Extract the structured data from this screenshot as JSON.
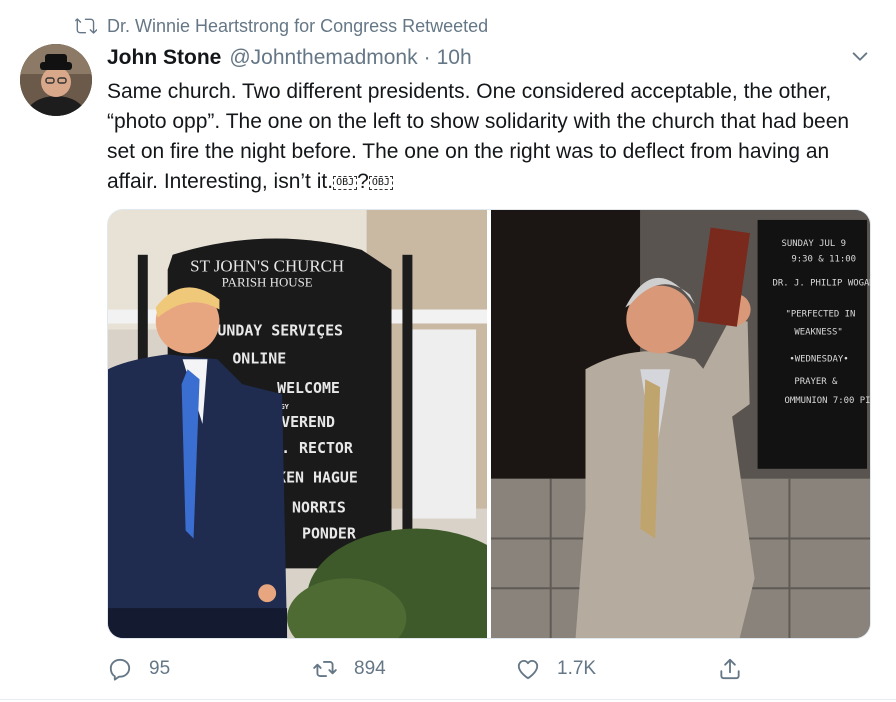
{
  "retweet_banner": {
    "icon": "retweet-icon",
    "text": "Dr. Winnie Heartstrong for Congress Retweeted"
  },
  "tweet": {
    "author_name": "John Stone",
    "author_handle": "@Johnthemadmonk",
    "separator": "·",
    "timestamp": "10h",
    "text_main": "Same church. Two different presidents.  One considered acceptable, the other,  “photo opp”. The one on the left to show solidarity with the church that had been set on fire the night before. The one on the right was to deflect from having an affair.  Interesting, isn’t it.",
    "emoji_placeholders": [
      "OBJ",
      "?",
      "OBJ"
    ]
  },
  "media": {
    "left_sign": {
      "arch_line1": "ST JOHN'S CHURCH",
      "arch_line2": "PARISH HOUSE",
      "lines": [
        "UNDAY SERVIÇES",
        "ONLINE",
        "WELCOME",
        "ERGY",
        "EVEREND",
        "R. RECTOR",
        "KEN HAGUE",
        "NORRIS",
        "PONDER"
      ]
    },
    "right_sign": {
      "lines": [
        "SUNDAY  JUL 9",
        "9:30  &  11:00",
        "DR. J. PHILIP WOGAM",
        "\"PERFECTED IN",
        "WEAKNESS\"",
        "•WEDNESDAY•",
        "PRAYER &",
        "OMMUNION  7:00 PI"
      ]
    }
  },
  "actions": {
    "reply": {
      "icon": "reply-icon",
      "count": "95"
    },
    "retweet": {
      "icon": "retweet-icon",
      "count": "894"
    },
    "like": {
      "icon": "heart-icon",
      "count": "1.7K"
    },
    "share": {
      "icon": "share-icon"
    }
  },
  "colors": {
    "muted": "#657786",
    "text": "#14171a",
    "border": "#e6ecf0"
  }
}
